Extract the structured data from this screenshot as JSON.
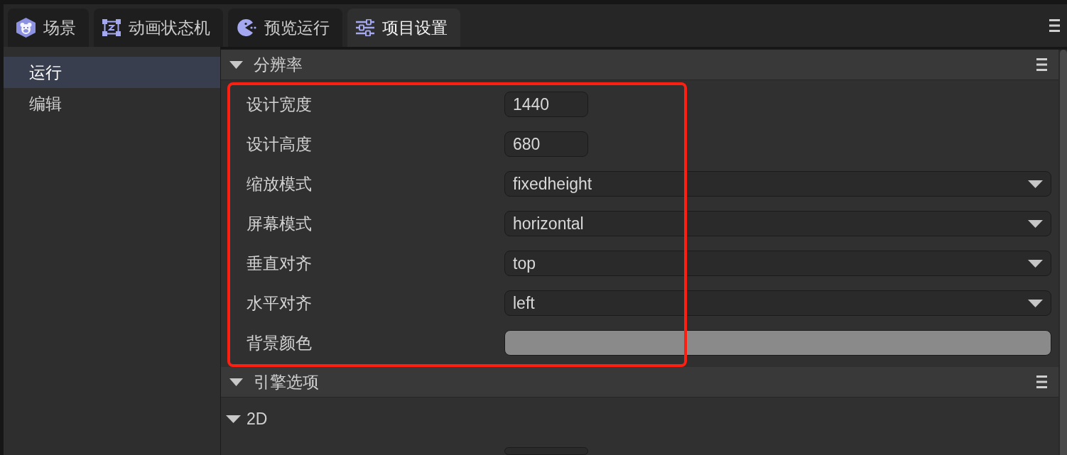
{
  "tabs": [
    {
      "label": "场景",
      "selected": false
    },
    {
      "label": "动画状态机",
      "selected": false
    },
    {
      "label": "预览运行",
      "selected": false
    },
    {
      "label": "项目设置",
      "selected": true
    }
  ],
  "sidebar": {
    "items": [
      {
        "label": "运行",
        "selected": true
      },
      {
        "label": "编辑",
        "selected": false
      }
    ]
  },
  "sections": [
    {
      "title": "分辨率",
      "expanded": true,
      "highlighted": true,
      "rows": [
        {
          "kind": "number",
          "label": "设计宽度",
          "value": "1440"
        },
        {
          "kind": "number",
          "label": "设计高度",
          "value": "680"
        },
        {
          "kind": "select",
          "label": "缩放模式",
          "value": "fixedheight"
        },
        {
          "kind": "select",
          "label": "屏幕模式",
          "value": "horizontal"
        },
        {
          "kind": "select",
          "label": "垂直对齐",
          "value": "top"
        },
        {
          "kind": "select",
          "label": "水平对齐",
          "value": "left"
        },
        {
          "kind": "color",
          "label": "背景颜色",
          "color": "#8a8a8a"
        }
      ]
    },
    {
      "title": "引擎选项",
      "expanded": true,
      "groups": [
        {
          "title": "2D",
          "expanded": true,
          "rows": [
            {
              "kind": "number"
            }
          ]
        }
      ]
    }
  ]
}
